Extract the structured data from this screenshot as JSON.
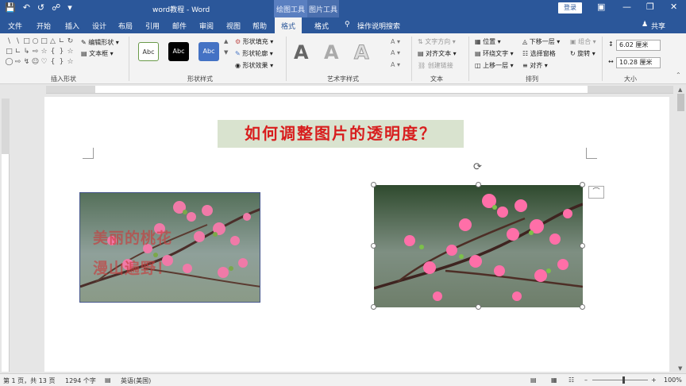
{
  "titlebar": {
    "doc_title": "word教程  -  Word",
    "ctx_drawing": "绘图工具",
    "ctx_picture": "图片工具",
    "login": "登录",
    "icons": [
      "save-icon",
      "undo-icon",
      "redo-icon",
      "touch-mode-icon",
      "customize-icon"
    ]
  },
  "tabs": {
    "items": [
      "文件",
      "开始",
      "插入",
      "设计",
      "布局",
      "引用",
      "邮件",
      "审阅",
      "视图",
      "帮助",
      "格式",
      "格式"
    ],
    "active_index": 10,
    "search_placeholder": "操作说明搜索",
    "share": "共享"
  },
  "ribbon": {
    "insert_shapes": {
      "label": "插入形状",
      "edit_shape": "编辑形状",
      "text_box": "文本框"
    },
    "shape_styles": {
      "label": "形状样式",
      "style_text": "Abc",
      "fill": "形状填充",
      "outline": "形状轮廓",
      "effects": "形状效果"
    },
    "wordart": {
      "label": "艺术字样式",
      "letter": "A"
    },
    "text": {
      "label": "文本",
      "direction": "文字方向",
      "align": "对齐文本",
      "link": "创建链接"
    },
    "arrange": {
      "label": "排列",
      "position": "位置",
      "wrap": "环绕文字",
      "forward": "上移一层",
      "backward": "下移一层",
      "pane": "选择窗格",
      "align": "对齐",
      "group": "组合",
      "rotate": "旋转"
    },
    "size": {
      "label": "大小",
      "height": "6.02 厘米",
      "width": "10.28 厘米"
    }
  },
  "document": {
    "heading": "如何调整图片的透明度？",
    "overlay_line1": "美丽的桃花",
    "overlay_line2": "漫山遍野！"
  },
  "status": {
    "page": "第 1 页，共 13 页",
    "words": "1294 个字",
    "language": "英语(美国)",
    "zoom": "100%"
  },
  "colors": {
    "brand": "#2b579a",
    "heading_red": "#d81e1e",
    "heading_bg": "#d9e3cf"
  }
}
